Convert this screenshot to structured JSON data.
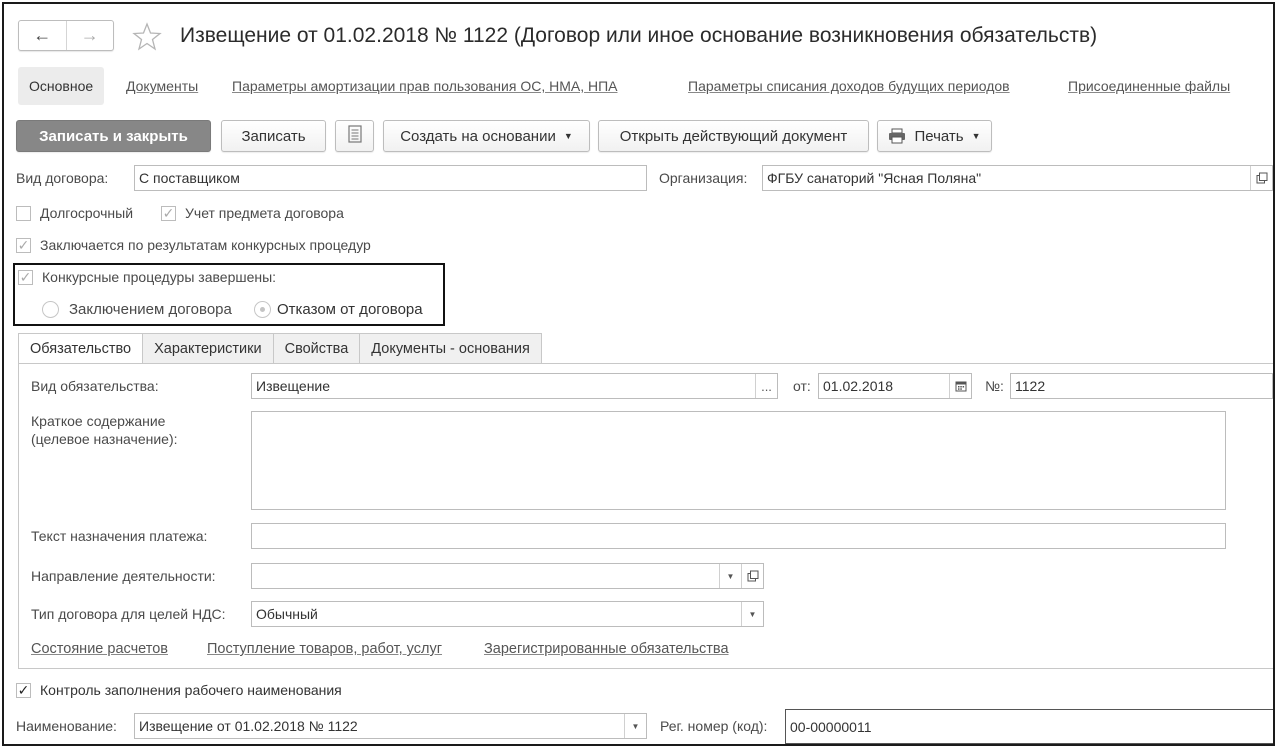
{
  "window": {
    "title": "Извещение от 01.02.2018 № 1122 (Договор или иное основание возникновения обязательств)",
    "nav_back": "←",
    "nav_forward": "→"
  },
  "sections": {
    "main": "Основное",
    "documents": "Документы",
    "amortization": "Параметры амортизации прав пользования ОС, НМА, НПА",
    "deferred_income": "Параметры списания доходов будущих периодов",
    "attached_files": "Присоединенные файлы"
  },
  "toolbar": {
    "save_close": "Записать и закрыть",
    "save": "Записать",
    "create_based": "Создать на основании",
    "open_current": "Открыть действующий документ",
    "print": "Печать"
  },
  "form": {
    "contract_kind_label": "Вид договора:",
    "contract_kind_value": "С поставщиком",
    "org_label": "Организация:",
    "org_value": "ФГБУ санаторий \"Ясная Поляна\"",
    "long_term_label": "Долгосрочный",
    "subject_accounting_label": "Учет предмета договора",
    "competitive_label": "Заключается по результатам конкурсных процедур",
    "competitive_done_label": "Конкурсные процедуры завершены:",
    "radio_conclusion": "Заключением договора",
    "radio_refusal": "Отказом от договора"
  },
  "tabs": [
    "Обязательство",
    "Характеристики",
    "Свойства",
    "Документы - основания"
  ],
  "obligation": {
    "kind_label": "Вид обязательства:",
    "kind_value": "Извещение",
    "date_label": "от:",
    "date_value": "01.02.2018",
    "num_label": "№:",
    "num_value": "1122",
    "summary_label_1": "Краткое содержание",
    "summary_label_2": "(целевое назначение):",
    "summary_value": "",
    "payment_text_label": "Текст назначения платежа:",
    "payment_text_value": "",
    "activity_label": "Направление деятельности:",
    "activity_value": "",
    "vat_type_label": "Тип договора для целей НДС:",
    "vat_type_value": "Обычный",
    "link_settlements": "Состояние расчетов",
    "link_receipts": "Поступление товаров, работ, услуг",
    "link_registered": "Зарегистрированные обязательства"
  },
  "bottom": {
    "control_label": "Контроль заполнения рабочего наименования",
    "name_label": "Наименование:",
    "name_value": "Извещение от 01.02.2018 № 1122",
    "reg_label": "Рег. номер (код):",
    "reg_value": "00-00000011"
  }
}
